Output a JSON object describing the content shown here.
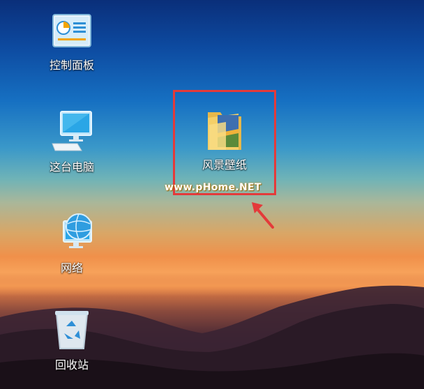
{
  "desktop": {
    "icons": [
      {
        "label": "控制面板",
        "icon": "control-panel-icon"
      },
      {
        "label": "这台电脑",
        "icon": "computer-icon"
      },
      {
        "label": "网络",
        "icon": "network-icon"
      },
      {
        "label": "回收站",
        "icon": "recycle-bin-icon"
      },
      {
        "label": "风景壁纸",
        "icon": "folder-icon"
      }
    ]
  },
  "watermark": "www.pHome.NET",
  "colors": {
    "highlight": "#e43a3a",
    "arrow": "#e43a3a"
  }
}
